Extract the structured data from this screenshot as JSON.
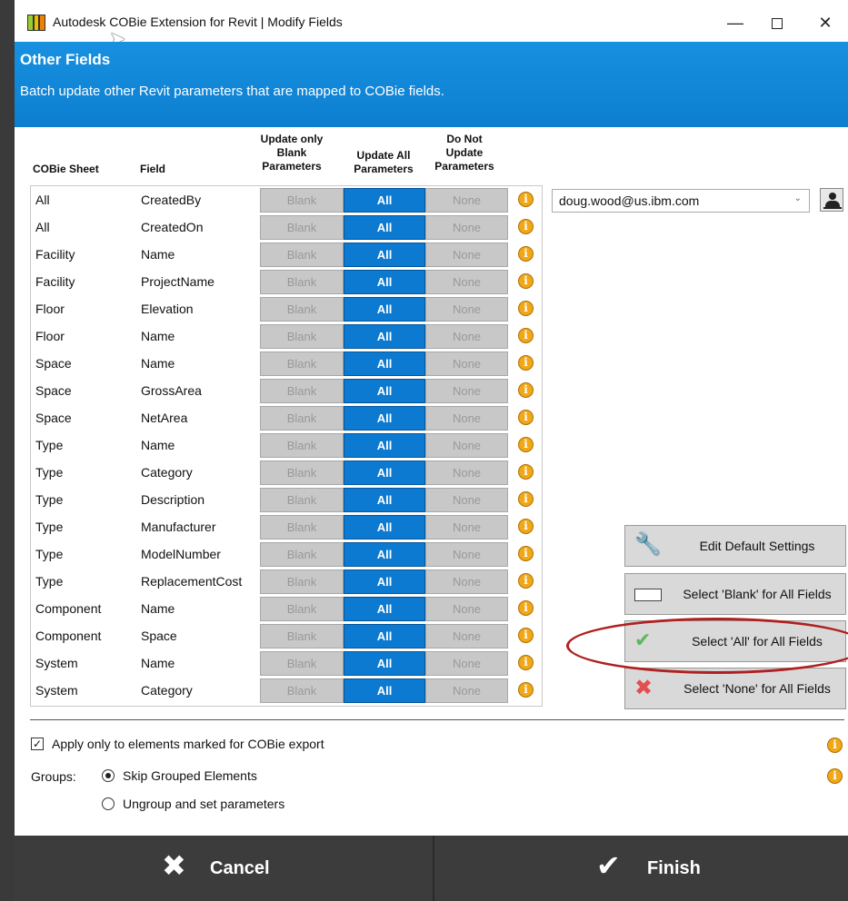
{
  "window": {
    "title": "Autodesk COBie Extension for Revit | Modify Fields",
    "minimize": "—",
    "close": "✕"
  },
  "header": {
    "title": "Other Fields",
    "subtitle": "Batch update other Revit parameters that are mapped to COBie fields."
  },
  "table": {
    "headers": {
      "sheet": "COBie Sheet",
      "field": "Field",
      "blank": "Update only Blank Parameters",
      "all": "Update All Parameters",
      "none": "Do Not Update Parameters"
    },
    "option_labels": {
      "blank": "Blank",
      "all": "All",
      "none": "None"
    },
    "rows": [
      {
        "sheet": "All",
        "field": "CreatedBy",
        "selected": "All"
      },
      {
        "sheet": "All",
        "field": "CreatedOn",
        "selected": "All"
      },
      {
        "sheet": "Facility",
        "field": "Name",
        "selected": "All"
      },
      {
        "sheet": "Facility",
        "field": "ProjectName",
        "selected": "All"
      },
      {
        "sheet": "Floor",
        "field": "Elevation",
        "selected": "All"
      },
      {
        "sheet": "Floor",
        "field": "Name",
        "selected": "All"
      },
      {
        "sheet": "Space",
        "field": "Name",
        "selected": "All"
      },
      {
        "sheet": "Space",
        "field": "GrossArea",
        "selected": "All"
      },
      {
        "sheet": "Space",
        "field": "NetArea",
        "selected": "All"
      },
      {
        "sheet": "Type",
        "field": "Name",
        "selected": "All"
      },
      {
        "sheet": "Type",
        "field": "Category",
        "selected": "All"
      },
      {
        "sheet": "Type",
        "field": "Description",
        "selected": "All"
      },
      {
        "sheet": "Type",
        "field": "Manufacturer",
        "selected": "All"
      },
      {
        "sheet": "Type",
        "field": "ModelNumber",
        "selected": "All"
      },
      {
        "sheet": "Type",
        "field": "ReplacementCost",
        "selected": "All"
      },
      {
        "sheet": "Component",
        "field": "Name",
        "selected": "All"
      },
      {
        "sheet": "Component",
        "field": "Space",
        "selected": "All"
      },
      {
        "sheet": "System",
        "field": "Name",
        "selected": "All"
      },
      {
        "sheet": "System",
        "field": "Category",
        "selected": "All"
      }
    ]
  },
  "user": {
    "selected": "doug.wood@us.ibm.com"
  },
  "actions": {
    "edit_defaults": "Edit Default Settings",
    "select_blank": "Select 'Blank' for All Fields",
    "select_all": "Select 'All' for All Fields",
    "select_none": "Select 'None' for All Fields"
  },
  "options": {
    "apply_only_label": "Apply only to elements marked for COBie export",
    "apply_only_checked": true,
    "groups_label": "Groups:",
    "skip_grouped": "Skip Grouped Elements",
    "ungroup": "Ungroup and set parameters",
    "groups_selected": "skip"
  },
  "footer": {
    "cancel": "Cancel",
    "finish": "Finish"
  },
  "colors": {
    "header_blue": "#0c7ed0",
    "selected_all": "#0b7ad0",
    "highlight_ring": "#b02020"
  }
}
